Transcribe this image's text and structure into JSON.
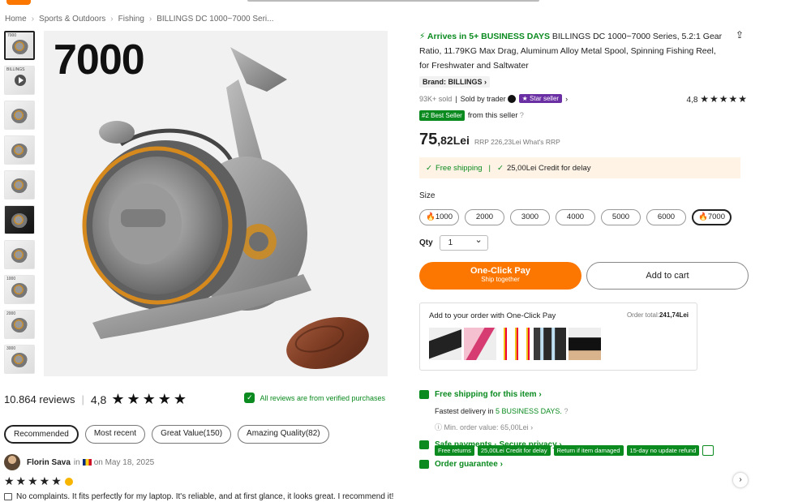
{
  "breadcrumb": [
    "Home",
    "Sports & Outdoors",
    "Fishing",
    "BILLINGS DC 1000~7000 Seri..."
  ],
  "gallery": {
    "size_overlay": "7000",
    "thumb_labels": [
      "7000",
      "BILLINGS",
      "",
      "",
      "",
      "",
      "",
      "1000",
      "2000",
      "3000"
    ]
  },
  "reviews": {
    "count": "10.864 reviews",
    "rating": "4,8",
    "stars": "★★★★★",
    "verified_text": "All reviews are from verified purchases",
    "filters": [
      "Recommended",
      "Most recent",
      "Great Value(150)",
      "Amazing Quality(82)"
    ],
    "first": {
      "name": "Florin Sava",
      "in": "in",
      "date": "on May 18, 2025",
      "stars": "★★★★★",
      "text": "No complaints. It fits perfectly for my laptop. It's reliable, and at first glance, it looks great. I recommend it!"
    }
  },
  "product": {
    "arrives": "Arrives in 5+ BUSINESS DAYS",
    "title": "BILLINGS DC 1000~7000 Series, 5.2:1 Gear Ratio, 11.79KG Max Drag, Aluminum Alloy Metal Spool, Spinning Fishing Reel, for Freshwater and Saltwater",
    "brand": "Brand: BILLINGS ›",
    "sold": "93K+ sold",
    "sold_by": "Sold by trader",
    "star_seller": "★ Star seller",
    "rating": "4,8",
    "rating_stars": "★★★★★",
    "best_seller_badge": "#2 Best Seller",
    "best_seller_text": "from this seller",
    "price_main": "75",
    "price_decimal": ",82Lei",
    "rrp": "RRP 226,23Lei What's RRP",
    "free_shipping": "Free shipping",
    "credit": "25,00Lei Credit for delay",
    "size_label": "Size",
    "sizes": [
      "1000",
      "2000",
      "3000",
      "4000",
      "5000",
      "6000",
      "7000"
    ],
    "qty_label": "Qty",
    "qty_value": "1",
    "oneclick_label": "One-Click Pay",
    "oneclick_sub": "Ship together",
    "add_to_cart": "Add to cart"
  },
  "addon": {
    "heading": "Add to your order with One-Click Pay",
    "order_total_label": "Order total:",
    "order_total_value": "241,74Lei"
  },
  "shipping": {
    "free_title": "Free shipping for this item ›",
    "fastest": "Fastest delivery in",
    "fastest_days": "5 BUSINESS DAYS.",
    "min_order": "Min. order value: 65,00Lei ›",
    "safe": "Safe payments · Secure privacy ›",
    "guarantee": "Order guarantee ›",
    "tags": [
      "Free returns",
      "25,00Lei Credit for delay",
      "Return if item damaged",
      "15-day no update refund"
    ]
  },
  "colors": {
    "accent": "#fb7701",
    "green": "#0a8a1f",
    "star_seller": "#6a2fa3"
  }
}
